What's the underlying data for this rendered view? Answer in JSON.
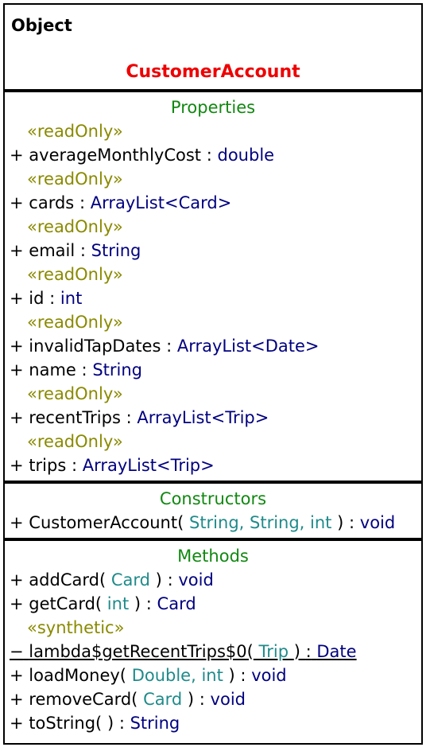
{
  "header": {
    "kind": "Object",
    "class_name": "CustomerAccount"
  },
  "properties": {
    "title": "Properties",
    "items": [
      {
        "stereotype": "«readOnly»",
        "visibility": "+",
        "name": "averageMonthlyCost",
        "sep": ":",
        "type": "double"
      },
      {
        "stereotype": "«readOnly»",
        "visibility": "+",
        "name": "cards",
        "sep": ":",
        "type": "ArrayList<Card>"
      },
      {
        "stereotype": "«readOnly»",
        "visibility": "+",
        "name": "email",
        "sep": ":",
        "type": "String"
      },
      {
        "stereotype": "«readOnly»",
        "visibility": "+",
        "name": "id",
        "sep": ":",
        "type": "int"
      },
      {
        "stereotype": "«readOnly»",
        "visibility": "+",
        "name": "invalidTapDates",
        "sep": ":",
        "type": "ArrayList<Date>"
      },
      {
        "stereotype": "",
        "visibility": "+",
        "name": "name",
        "sep": ":",
        "type": "String"
      },
      {
        "stereotype": "«readOnly»",
        "visibility": "+",
        "name": "recentTrips",
        "sep": ":",
        "type": "ArrayList<Trip>"
      },
      {
        "stereotype": "«readOnly»",
        "visibility": "+",
        "name": "trips",
        "sep": ":",
        "type": "ArrayList<Trip>"
      }
    ]
  },
  "constructors": {
    "title": "Constructors",
    "items": [
      {
        "visibility": "+",
        "name": "CustomerAccount(",
        "params": "String, String, int",
        "close": ")",
        "sep": ":",
        "ret": "void"
      }
    ]
  },
  "methods": {
    "title": "Methods",
    "items": [
      {
        "stereotype": "",
        "visibility": "+",
        "name": "addCard(",
        "params": "Card",
        "close": ")",
        "sep": ":",
        "ret": "void"
      },
      {
        "stereotype": "",
        "visibility": "+",
        "name": "getCard(",
        "params": "int",
        "close": ")",
        "sep": ":",
        "ret": "Card"
      },
      {
        "stereotype": "«synthetic»",
        "visibility": "−",
        "name": "lambda$getRecentTrips$0(",
        "params": "Trip",
        "close": ")",
        "sep": ":",
        "ret": "Date"
      },
      {
        "stereotype": "",
        "visibility": "+",
        "name": "loadMoney(",
        "params": "Double, int",
        "close": ")",
        "sep": ":",
        "ret": "void"
      },
      {
        "stereotype": "",
        "visibility": "+",
        "name": "removeCard(",
        "params": "Card",
        "close": ")",
        "sep": ":",
        "ret": "void"
      },
      {
        "stereotype": "",
        "visibility": "+",
        "name": "toString(",
        "params": "",
        "close": ")",
        "sep": ":",
        "ret": "String"
      }
    ]
  }
}
